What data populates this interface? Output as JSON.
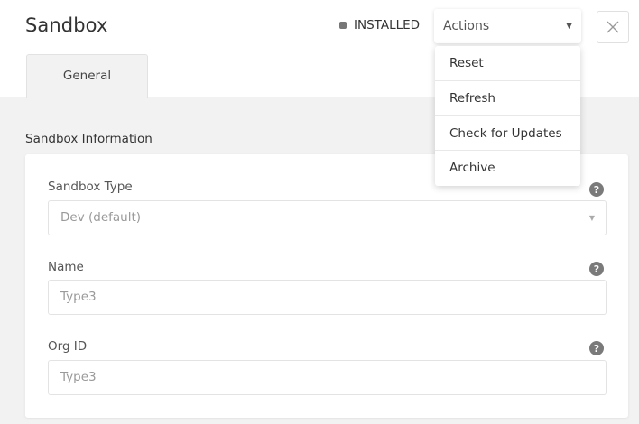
{
  "header": {
    "title": "Sandbox",
    "status_text": "INSTALLED",
    "actions_label": "Actions"
  },
  "tabs": [
    {
      "label": "General",
      "active": true
    }
  ],
  "actions_menu": {
    "items": [
      "Reset",
      "Refresh",
      "Check for Updates",
      "Archive"
    ]
  },
  "section": {
    "title": "Sandbox Information"
  },
  "fields": {
    "sandbox_type": {
      "label": "Sandbox Type",
      "value": "Dev (default)"
    },
    "name": {
      "label": "Name",
      "value": "Type3"
    },
    "org_id": {
      "label": "Org ID",
      "value": "Type3"
    },
    "help_glyph": "?"
  },
  "icons": {
    "status": "square-dot-icon",
    "actions_caret": "caret-down-icon",
    "close": "close-icon",
    "help": "question-circle-icon",
    "select_caret": "caret-down-icon"
  },
  "colors": {
    "page_bg": "#f2f2f2",
    "card_bg": "#ffffff",
    "text": "#333333",
    "muted_text": "#9a9a9a",
    "help_icon": "#7a7a7a",
    "status_dot": "#777777"
  }
}
